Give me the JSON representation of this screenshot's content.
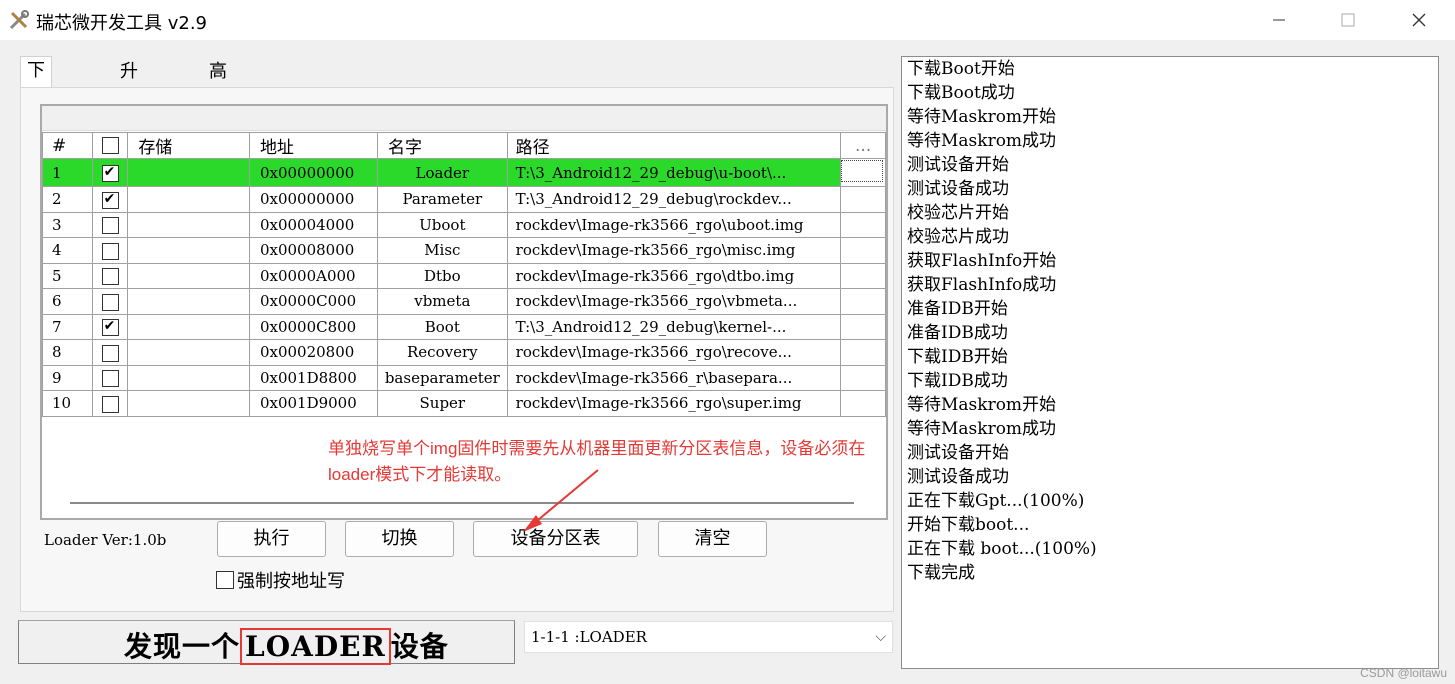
{
  "window": {
    "title": "瑞芯微开发工具 v2.9",
    "minimize_icon": "minimize-icon",
    "maximize_icon": "maximize-icon",
    "close_icon": "close-icon"
  },
  "tabs": [
    {
      "label": "下载镜像",
      "active": true
    },
    {
      "label": "升级固件",
      "active": false
    },
    {
      "label": "高级功能",
      "active": false
    }
  ],
  "grid": {
    "headers": {
      "num": "#",
      "check": "☐",
      "storage": "存储",
      "address": "地址",
      "name": "名字",
      "path": "路径",
      "more": "..."
    },
    "rows": [
      {
        "num": "1",
        "checked": true,
        "storage": "",
        "address": "0x00000000",
        "name": "Loader",
        "path": "T:\\3_Android12_29_debug\\u-boot\\...",
        "selected": true
      },
      {
        "num": "2",
        "checked": true,
        "storage": "",
        "address": "0x00000000",
        "name": "Parameter",
        "path": "T:\\3_Android12_29_debug\\rockdev...",
        "selected": false
      },
      {
        "num": "3",
        "checked": false,
        "storage": "",
        "address": "0x00004000",
        "name": "Uboot",
        "path": "rockdev\\Image-rk3566_rgo\\uboot.img",
        "selected": false
      },
      {
        "num": "4",
        "checked": false,
        "storage": "",
        "address": "0x00008000",
        "name": "Misc",
        "path": "rockdev\\Image-rk3566_rgo\\misc.img",
        "selected": false
      },
      {
        "num": "5",
        "checked": false,
        "storage": "",
        "address": "0x0000A000",
        "name": "Dtbo",
        "path": "rockdev\\Image-rk3566_rgo\\dtbo.img",
        "selected": false
      },
      {
        "num": "6",
        "checked": false,
        "storage": "",
        "address": "0x0000C000",
        "name": "vbmeta",
        "path": "rockdev\\Image-rk3566_rgo\\vbmeta...",
        "selected": false
      },
      {
        "num": "7",
        "checked": true,
        "storage": "",
        "address": "0x0000C800",
        "name": "Boot",
        "path": "T:\\3_Android12_29_debug\\kernel-...",
        "selected": false
      },
      {
        "num": "8",
        "checked": false,
        "storage": "",
        "address": "0x00020800",
        "name": "Recovery",
        "path": "rockdev\\Image-rk3566_rgo\\recove...",
        "selected": false
      },
      {
        "num": "9",
        "checked": false,
        "storage": "",
        "address": "0x001D8800",
        "name": "baseparameter",
        "path": "rockdev\\Image-rk3566_r\\basepara...",
        "selected": false
      },
      {
        "num": "10",
        "checked": false,
        "storage": "",
        "address": "0x001D9000",
        "name": "Super",
        "path": "rockdev\\Image-rk3566_rgo\\super.img",
        "selected": false
      }
    ]
  },
  "loader_version": "Loader Ver:1.0b",
  "buttons": {
    "execute": "执行",
    "switch": "切换",
    "device_partition": "设备分区表",
    "clear": "清空"
  },
  "force_address_write": {
    "label": "强制按地址写",
    "checked": false
  },
  "annotation": {
    "line1": "单独烧写单个img固件时需要先从机器里面更新分区表信息，设备必须在",
    "line2": "loader模式下才能读取。",
    "color": "#e53935"
  },
  "status": {
    "prefix": "发现一个",
    "highlight": "LOADER",
    "suffix": "设备"
  },
  "device_select": {
    "value": "1-1-1 :LOADER"
  },
  "log": [
    "下载Boot开始",
    "下载Boot成功",
    "等待Maskrom开始",
    "等待Maskrom成功",
    "测试设备开始",
    "测试设备成功",
    "校验芯片开始",
    "校验芯片成功",
    "获取FlashInfo开始",
    "获取FlashInfo成功",
    "准备IDB开始",
    "准备IDB成功",
    "下载IDB开始",
    "下载IDB成功",
    "等待Maskrom开始",
    "等待Maskrom成功",
    "测试设备开始",
    "测试设备成功",
    "正在下载Gpt...(100%)",
    "开始下载boot...",
    "正在下载 boot...(100%)",
    "下载完成"
  ],
  "watermark": "CSDN @loitawu",
  "colors": {
    "selected_row": "#2bd92b",
    "annotation": "#e53935",
    "highlight_box": "#e53935"
  }
}
